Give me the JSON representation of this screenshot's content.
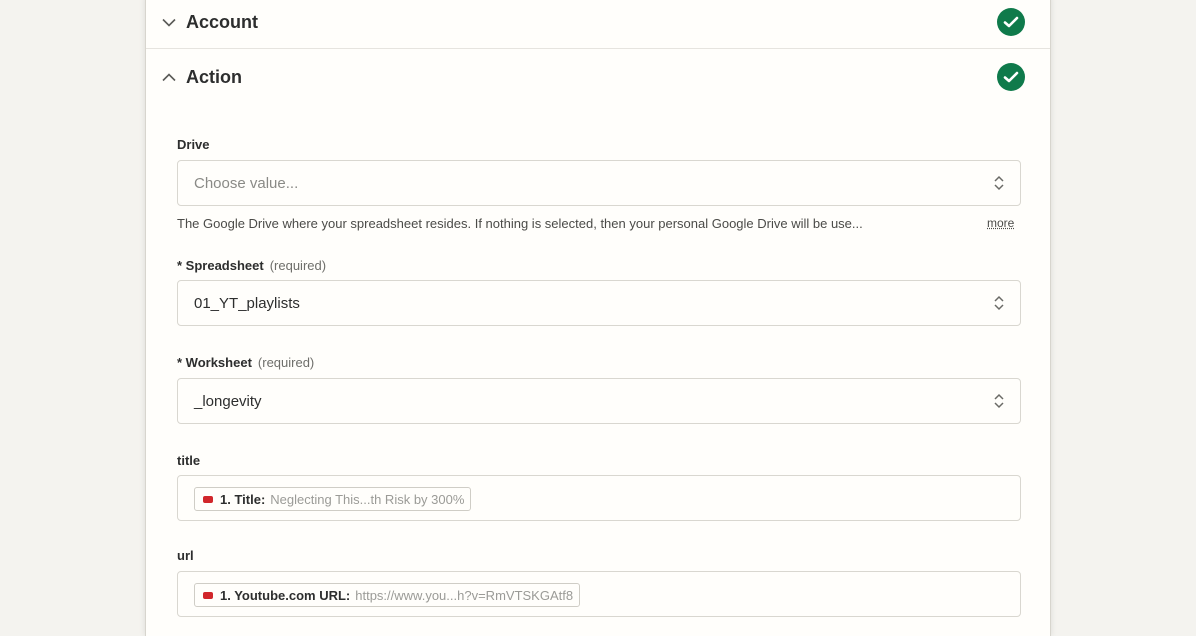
{
  "sections": {
    "account": {
      "title": "Account",
      "complete": true
    },
    "action": {
      "title": "Action",
      "complete": true
    }
  },
  "fields": {
    "drive": {
      "label": "Drive",
      "placeholder": "Choose value...",
      "help": "The Google Drive where your spreadsheet resides. If nothing is selected, then your personal Google Drive will be use...",
      "more": "more"
    },
    "spreadsheet": {
      "label": "* Spreadsheet",
      "required": "(required)",
      "value": "01_YT_playlists"
    },
    "worksheet": {
      "label": "* Worksheet",
      "required": "(required)",
      "value": "_longevity"
    },
    "title": {
      "label": "title",
      "pill_key": "1. Title:",
      "pill_value": "Neglecting This...th Risk by 300%"
    },
    "url": {
      "label": "url",
      "pill_key": "1. Youtube.com URL:",
      "pill_value": "https://www.you...h?v=RmVTSKGAtf8"
    }
  },
  "colors": {
    "check_green": "#0f7a4b",
    "youtube_red": "#d1262b",
    "page_bg": "#f4f3ef"
  }
}
